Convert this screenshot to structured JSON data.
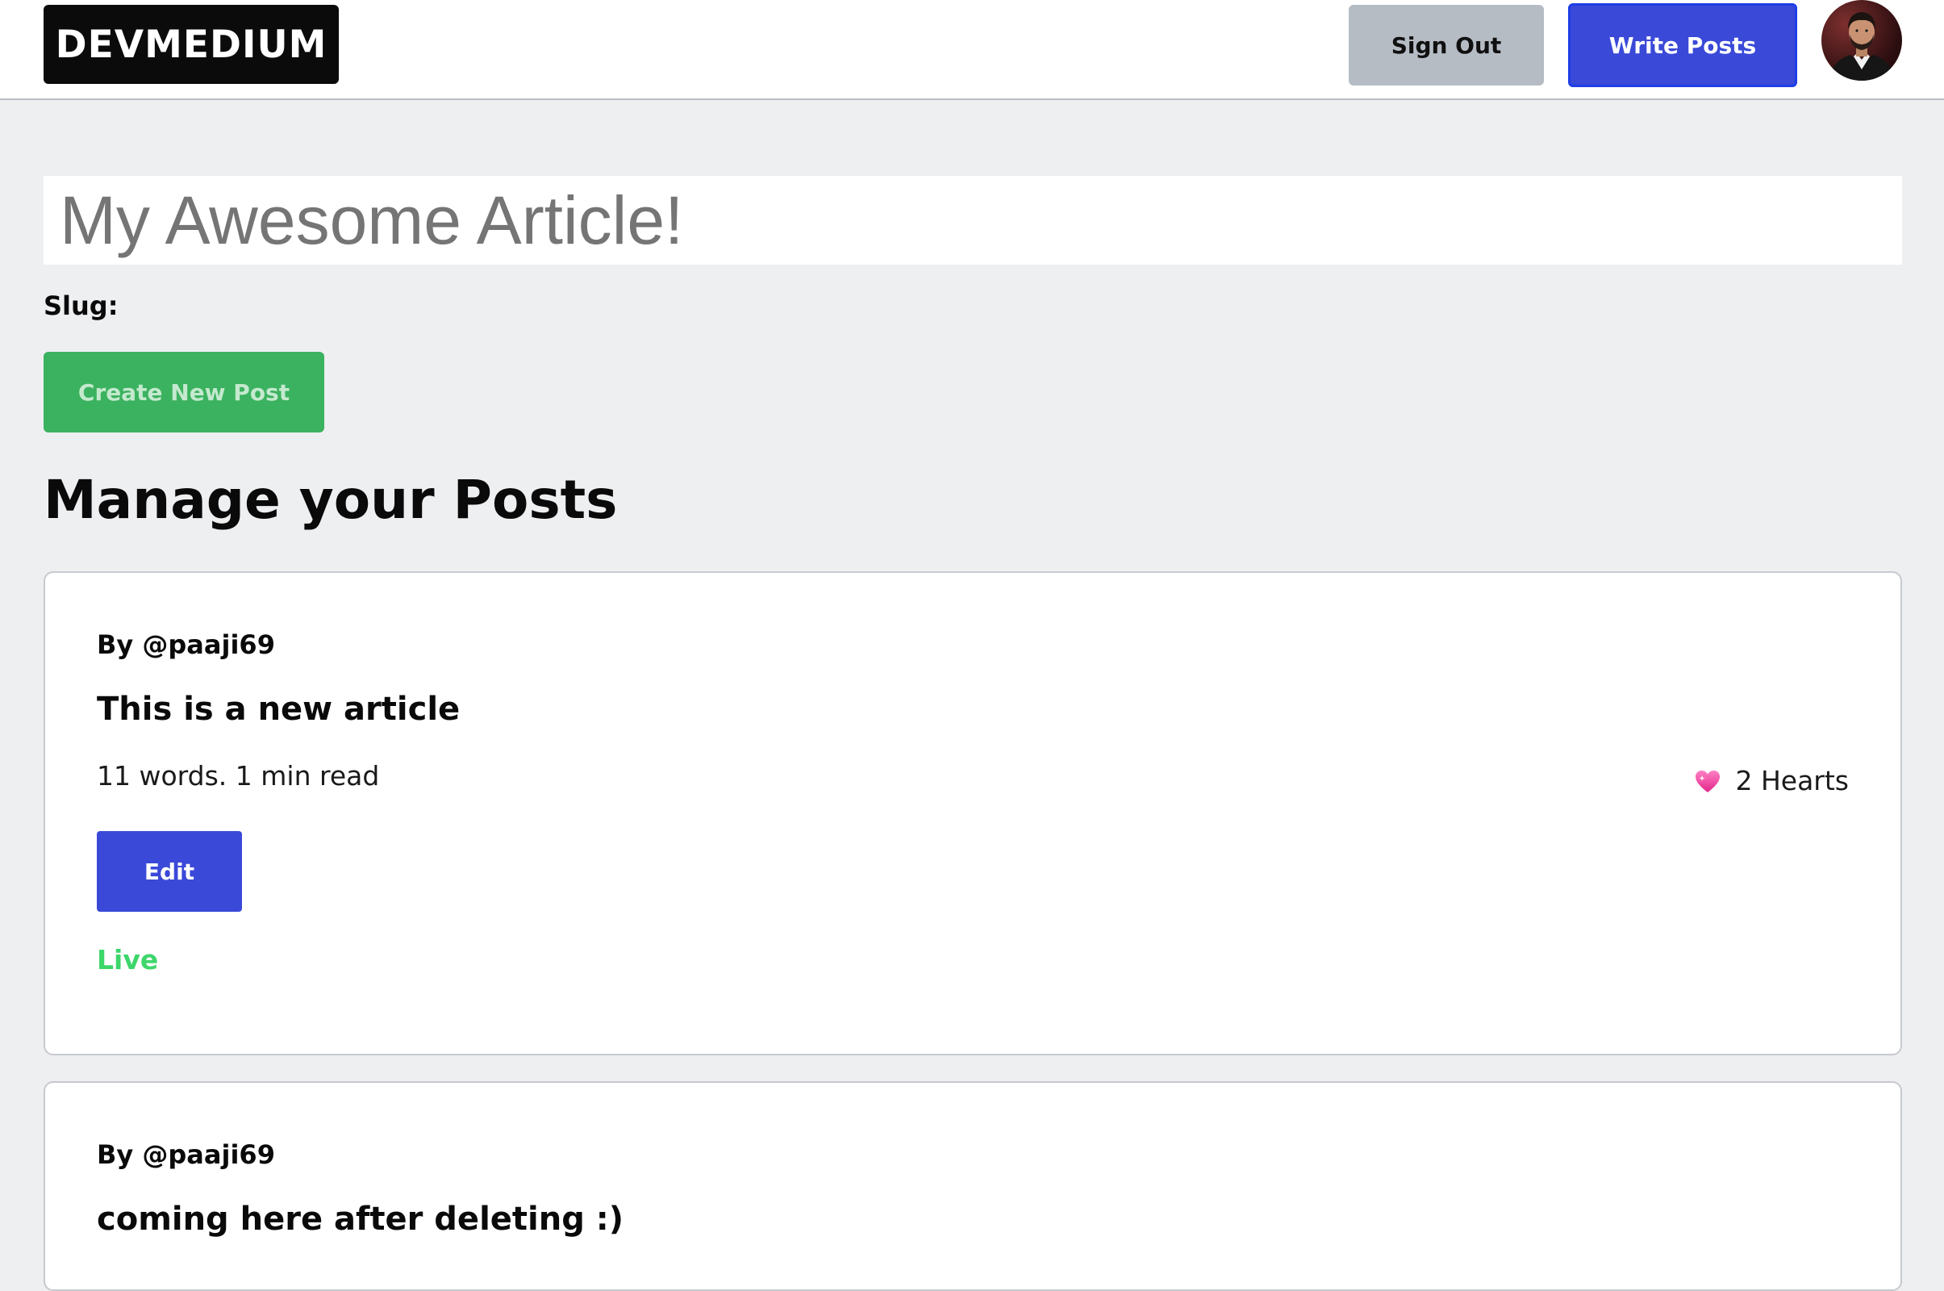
{
  "navbar": {
    "logo": "DEVMEDIUM",
    "sign_out_label": "Sign Out",
    "write_posts_label": "Write Posts",
    "avatar_icon": "user-avatar-icon"
  },
  "editor": {
    "title_placeholder": "My Awesome Article!",
    "slug_label": "Slug:",
    "create_button_label": "Create New Post"
  },
  "manage": {
    "heading": "Manage your Posts",
    "posts": [
      {
        "author": "By @paaji69",
        "title": "This is a new article",
        "meta": "11 words. 1 min read",
        "hearts_label": "2 Hearts",
        "heart_icon": "sparkling-heart-icon",
        "edit_label": "Edit",
        "status": "Live"
      },
      {
        "author": "By @paaji69",
        "title": "coming here after deleting :)"
      }
    ]
  },
  "colors": {
    "page_background": "#eeeff1",
    "primary_blue": "#3a49d8",
    "create_green": "#3bb25f",
    "live_green": "#3dd66b",
    "sign_out_gray": "#b6bcc4",
    "logo_black": "#0b0b0c"
  }
}
